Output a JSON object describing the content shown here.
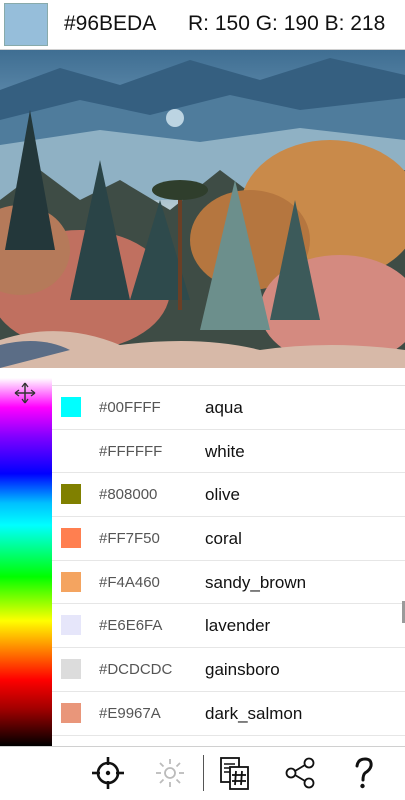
{
  "header": {
    "hex": "#96BEDA",
    "rgb": "R: 150 G: 190 B: 218",
    "swatch_color": "#96BEDA"
  },
  "image": {
    "description_icon": "landscape-image"
  },
  "colors": [
    {
      "hex": "#00FFFF",
      "name": "aqua",
      "color": "#00FFFF"
    },
    {
      "hex": "#FFFFFF",
      "name": "white",
      "color": "#FFFFFF"
    },
    {
      "hex": "#808000",
      "name": "olive",
      "color": "#808000"
    },
    {
      "hex": "#FF7F50",
      "name": "coral",
      "color": "#FF7F50"
    },
    {
      "hex": "#F4A460",
      "name": "sandy_brown",
      "color": "#F4A460"
    },
    {
      "hex": "#E6E6FA",
      "name": "lavender",
      "color": "#E6E6FA"
    },
    {
      "hex": "#DCDCDC",
      "name": "gainsboro",
      "color": "#DCDCDC"
    },
    {
      "hex": "#E9967A",
      "name": "dark_salmon",
      "color": "#E9967A"
    },
    {
      "hex": "",
      "name": "",
      "color": "#DDA0DD"
    }
  ],
  "toolbar": {
    "icons": [
      "crosshair-icon",
      "brightness-icon",
      "copy-hex-icon",
      "share-icon",
      "help-icon"
    ]
  }
}
